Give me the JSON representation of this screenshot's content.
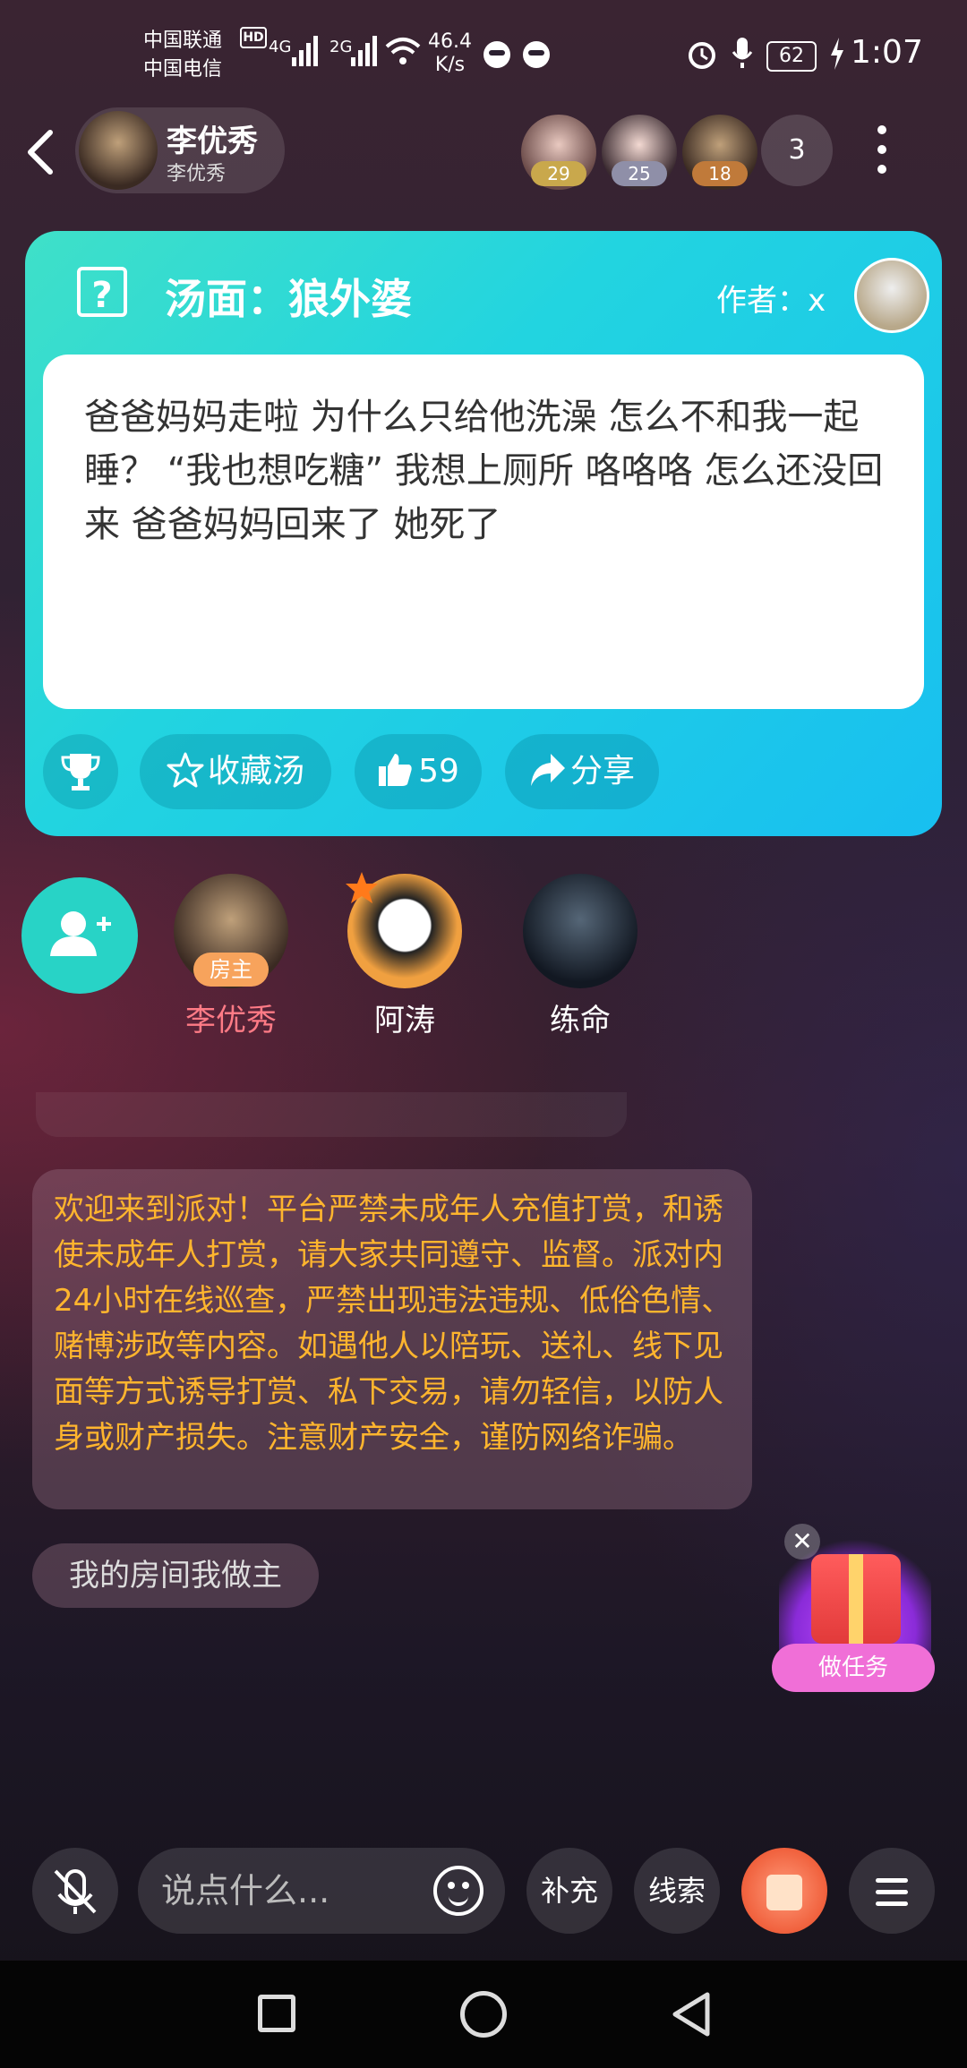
{
  "status": {
    "carrier1": "中国联通",
    "carrier2": "中国电信",
    "net1": "4G",
    "net2": "2G",
    "speed_value": "46.4",
    "speed_unit": "K/s",
    "battery": "62",
    "time": "1:07"
  },
  "header": {
    "host_name": "李优秀",
    "host_sub": "李优秀",
    "viewers": [
      {
        "badge": "29",
        "badge_color": "#c9a84c"
      },
      {
        "badge": "25",
        "badge_color": "#8f8fa8"
      },
      {
        "badge": "18",
        "badge_color": "#c07a3a"
      }
    ],
    "viewer_count": "3"
  },
  "card": {
    "title": "汤面：狼外婆",
    "author_label": "作者：",
    "author_name": "x",
    "body": "爸爸妈妈走啦 为什么只给他洗澡 怎么不和我一起睡？ “我也想吃糖” 我想上厕所 咯咯咯 怎么还没回来 爸爸妈妈回来了 她死了",
    "collect_label": "收藏汤",
    "like_count": "59",
    "share_label": "分享"
  },
  "seats": [
    {
      "name": "李优秀",
      "tag": "房主",
      "name_color": "#ff7b86"
    },
    {
      "name": "阿涛"
    },
    {
      "name": "练命"
    }
  ],
  "chat": {
    "notice": "欢迎来到派对！平台严禁未成年人充值打赏，和诱使未成年人打赏，请大家共同遵守、监督。派对内24小时在线巡查，严禁出现违法违规、低俗色情、赌博涉政等内容。如遇他人以陪玩、送礼、线下见面等方式诱导打赏、私下交易，请勿轻信，以防人身或财产损失。注意财产安全，谨防网络诈骗。",
    "message": "我的房间我做主"
  },
  "task": {
    "button_label": "做任务"
  },
  "bottom_bar": {
    "input_placeholder": "说点什么...",
    "supplement_label": "补充",
    "clue_label": "线索"
  }
}
